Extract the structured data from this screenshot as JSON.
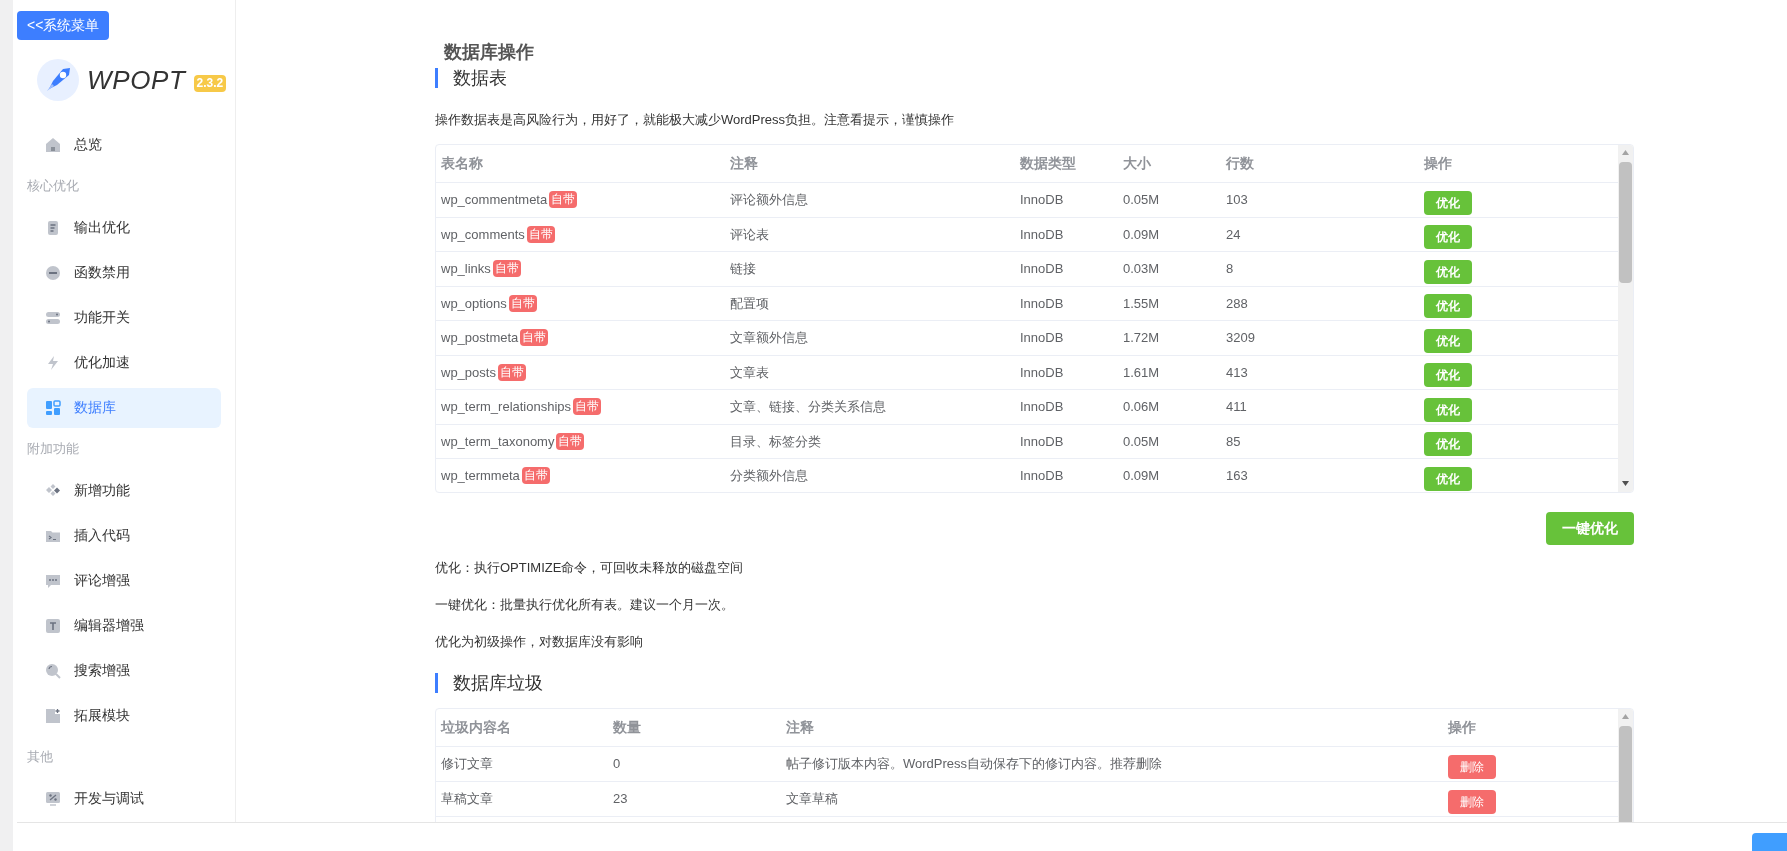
{
  "sidebar": {
    "menu_button": "<<系统菜单",
    "logo": {
      "name": "WPOPT",
      "version": "2.3.2"
    },
    "nav": [
      {
        "kind": "item",
        "label": "总览",
        "selected": false
      },
      {
        "kind": "heading",
        "label": "核心优化"
      },
      {
        "kind": "item",
        "label": "输出优化",
        "selected": false
      },
      {
        "kind": "item",
        "label": "函数禁用",
        "selected": false
      },
      {
        "kind": "item",
        "label": "功能开关",
        "selected": false
      },
      {
        "kind": "item",
        "label": "优化加速",
        "selected": false
      },
      {
        "kind": "item",
        "label": "数据库",
        "selected": true
      },
      {
        "kind": "heading",
        "label": "附加功能"
      },
      {
        "kind": "item",
        "label": "新增功能",
        "selected": false
      },
      {
        "kind": "item",
        "label": "插入代码",
        "selected": false
      },
      {
        "kind": "item",
        "label": "评论增强",
        "selected": false
      },
      {
        "kind": "item",
        "label": "编辑器增强",
        "selected": false
      },
      {
        "kind": "item",
        "label": "搜索增强",
        "selected": false
      },
      {
        "kind": "item",
        "label": "拓展模块",
        "selected": false
      },
      {
        "kind": "heading",
        "label": "其他"
      },
      {
        "kind": "item",
        "label": "开发与调试",
        "selected": false
      }
    ]
  },
  "page_title": "数据库操作",
  "tables_section": {
    "title": "数据表",
    "description": "操作数据表是高风险行为，用好了，就能极大减少WordPress负担。注意看提示，谨慎操作",
    "table": {
      "columns": [
        "表名称",
        "注释",
        "数据类型",
        "大小",
        "行数",
        "操作"
      ],
      "rows": [
        {
          "name": "wp_commentmeta",
          "badge": "自带",
          "comment": "评论额外信息",
          "engine": "InnoDB",
          "size": "0.05M",
          "row_count": "103",
          "action": "优化"
        },
        {
          "name": "wp_comments",
          "badge": "自带",
          "comment": "评论表",
          "engine": "InnoDB",
          "size": "0.09M",
          "row_count": "24",
          "action": "优化"
        },
        {
          "name": "wp_links",
          "badge": "自带",
          "comment": "链接",
          "engine": "InnoDB",
          "size": "0.03M",
          "row_count": "8",
          "action": "优化"
        },
        {
          "name": "wp_options",
          "badge": "自带",
          "comment": "配置项",
          "engine": "InnoDB",
          "size": "1.55M",
          "row_count": "288",
          "action": "优化"
        },
        {
          "name": "wp_postmeta",
          "badge": "自带",
          "comment": "文章额外信息",
          "engine": "InnoDB",
          "size": "1.72M",
          "row_count": "3209",
          "action": "优化"
        },
        {
          "name": "wp_posts",
          "badge": "自带",
          "comment": "文章表",
          "engine": "InnoDB",
          "size": "1.61M",
          "row_count": "413",
          "action": "优化"
        },
        {
          "name": "wp_term_relationships",
          "badge": "自带",
          "comment": "文章、链接、分类关系信息",
          "engine": "InnoDB",
          "size": "0.06M",
          "row_count": "411",
          "action": "优化"
        },
        {
          "name": "wp_term_taxonomy",
          "badge": "自带",
          "comment": "目录、标签分类",
          "engine": "InnoDB",
          "size": "0.05M",
          "row_count": "85",
          "action": "优化"
        },
        {
          "name": "wp_termmeta",
          "badge": "自带",
          "comment": "分类额外信息",
          "engine": "InnoDB",
          "size": "0.09M",
          "row_count": "163",
          "action": "优化"
        }
      ]
    },
    "optimize_all_button": "一键优化",
    "notes": [
      "优化：执行OPTIMIZE命令，可回收未释放的磁盘空间",
      "一键优化：批量执行优化所有表。建议一个月一次。",
      "优化为初级操作，对数据库没有影响"
    ]
  },
  "trash_section": {
    "title": "数据库垃圾",
    "table": {
      "columns": [
        "垃圾内容名",
        "数量",
        "注释",
        "操作"
      ],
      "rows": [
        {
          "name": "修订文章",
          "count": "0",
          "comment": "帖子修订版本内容。WordPress自动保存下的修订内容。推荐删除",
          "action": "删除"
        },
        {
          "name": "草稿文章",
          "count": "23",
          "comment": "文章草稿",
          "action": "删除"
        }
      ]
    }
  }
}
